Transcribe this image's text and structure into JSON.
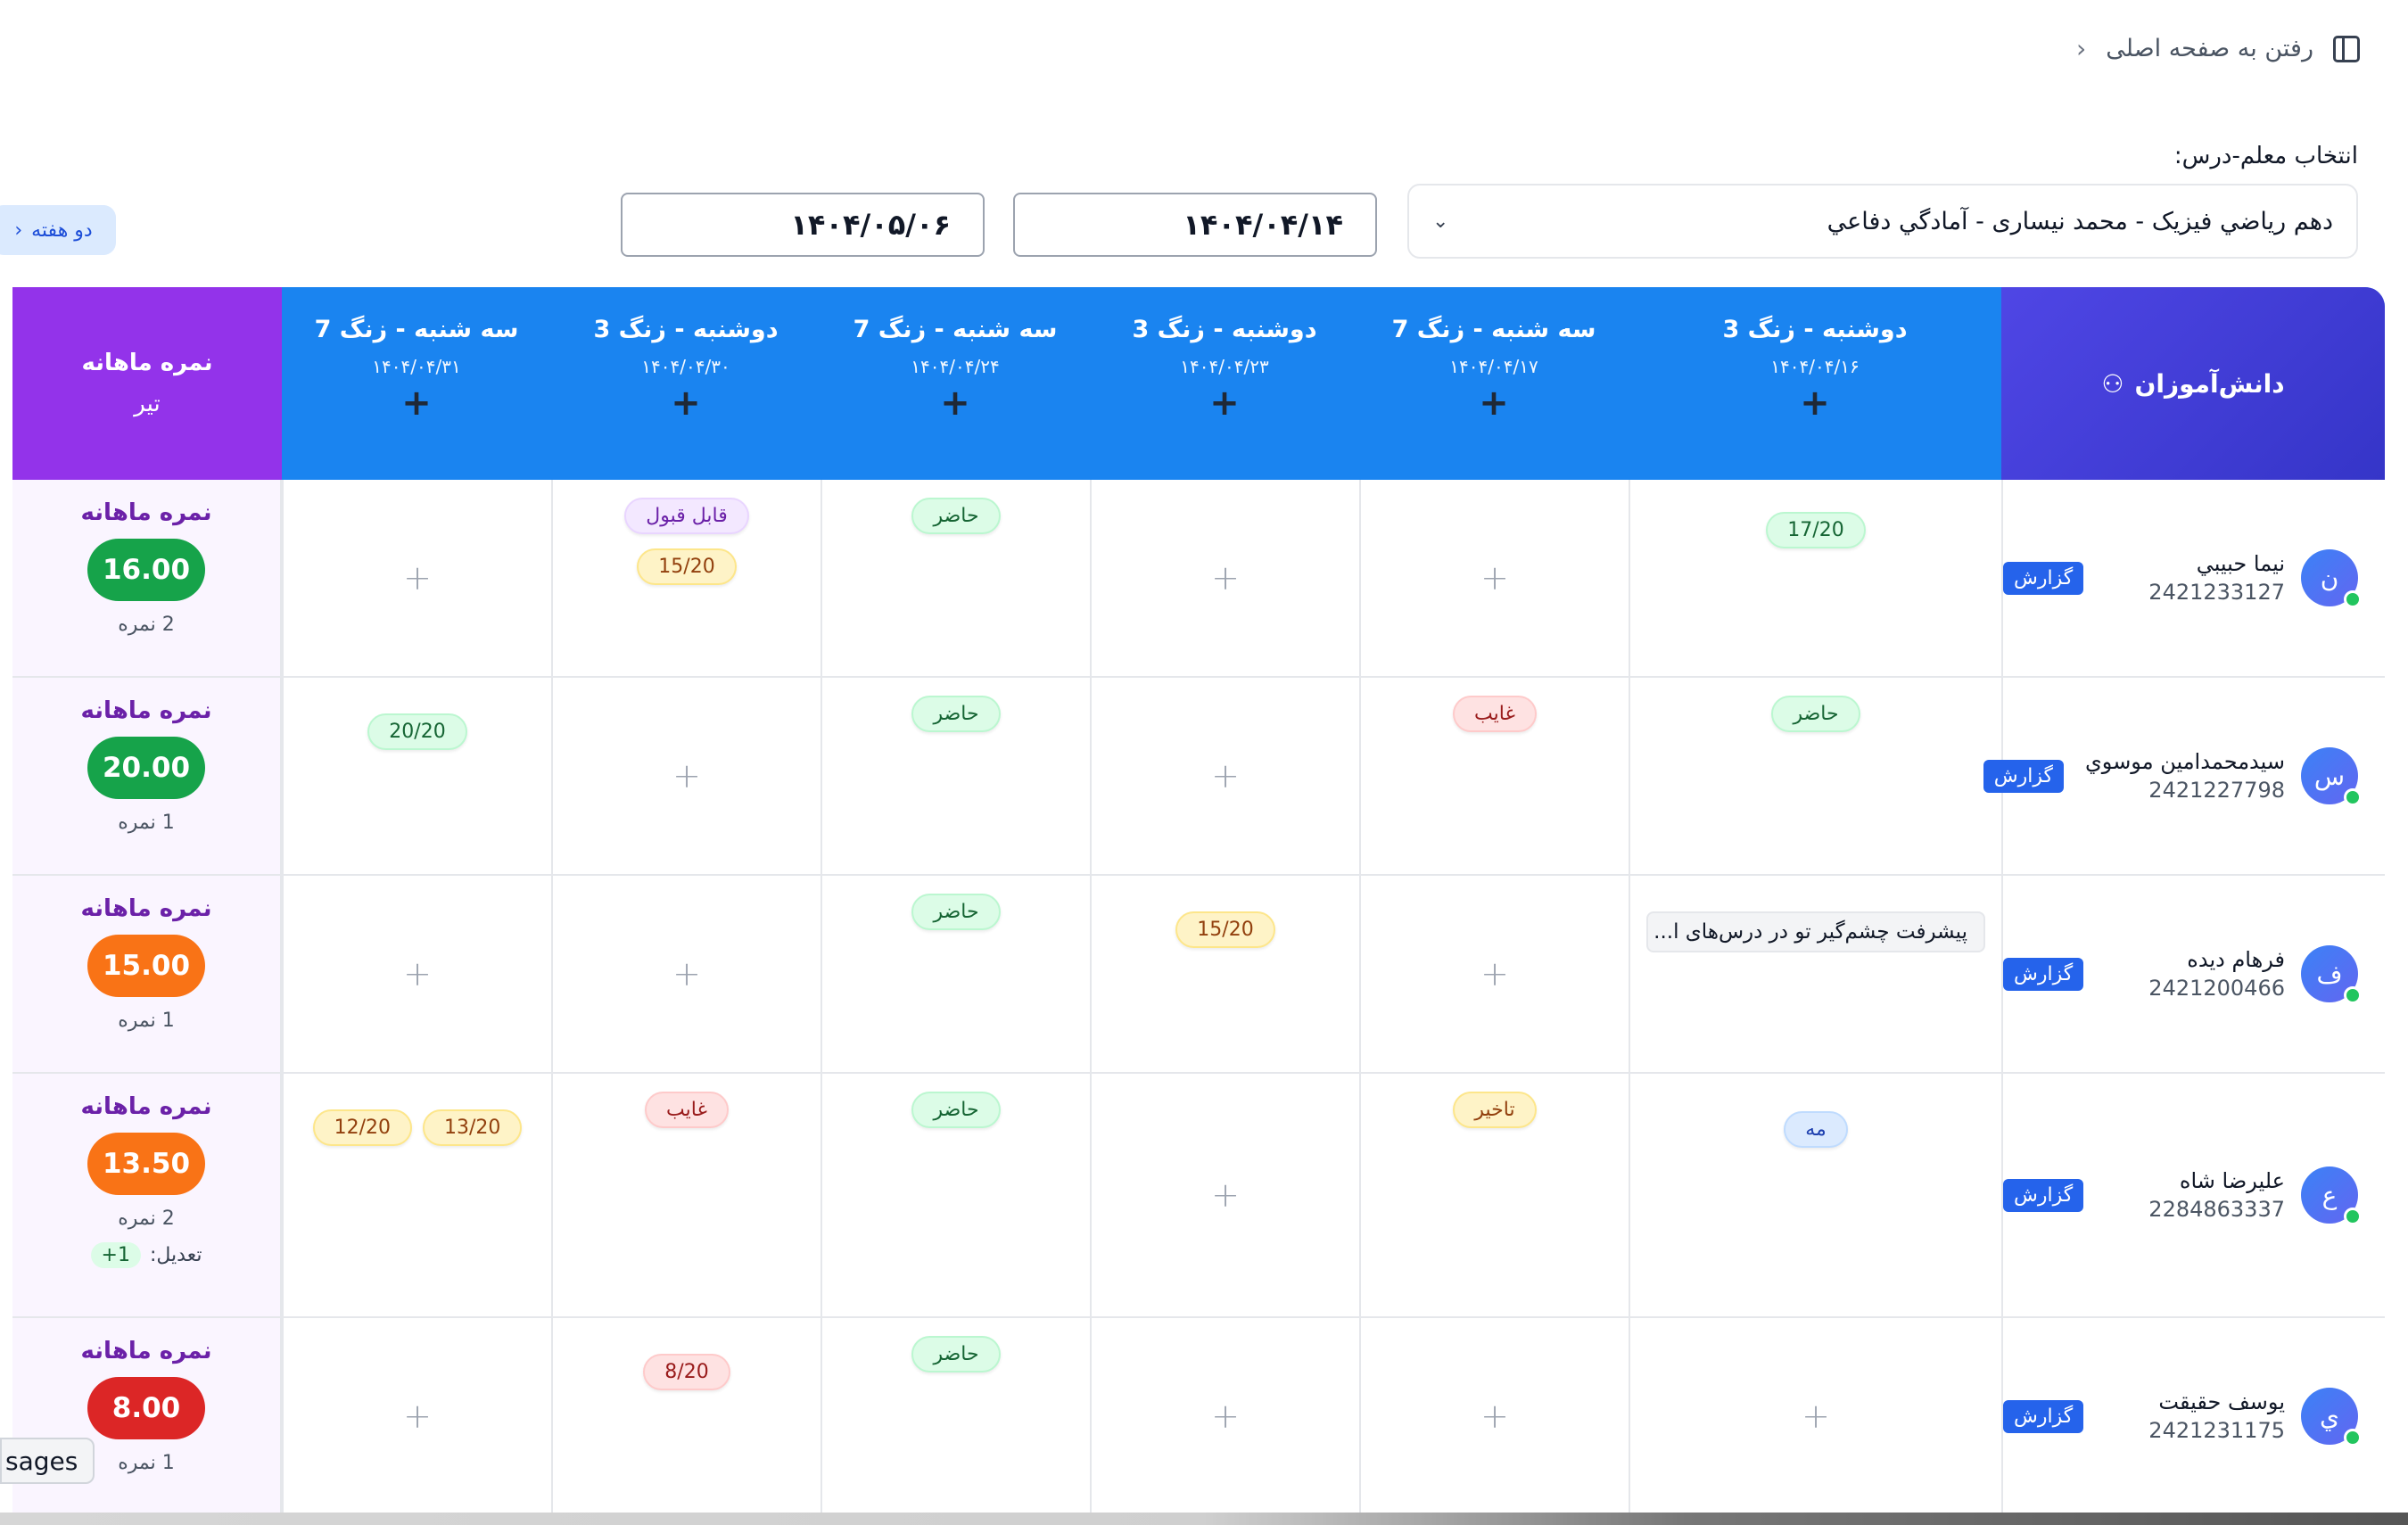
{
  "topbar": {
    "home_link": "رفتن به صفحه اصلی"
  },
  "filters": {
    "label": "انتخاب معلم-درس:",
    "course": "دهم رياضي فيزيک - محمد نيساری - آمادگي دفاعي",
    "date_from": "۱۴۰۴/۰۴/۱۴",
    "date_to": "۱۴۰۴/۰۵/۰۶",
    "period_button": "دو هفته"
  },
  "header": {
    "students": "دانش‌آموزان",
    "monthly_title": "نمره ماهانه",
    "monthly_month": "تیر",
    "add_symbol": "+",
    "sessions": [
      {
        "title": "دوشنبه - زنگ 3",
        "date": "۱۴۰۴/۰۴/۱۶"
      },
      {
        "title": "سه شنبه - زنگ 7",
        "date": "۱۴۰۴/۰۴/۱۷"
      },
      {
        "title": "دوشنبه - زنگ 3",
        "date": "۱۴۰۴/۰۴/۲۳"
      },
      {
        "title": "سه شنبه - زنگ 7",
        "date": "۱۴۰۴/۰۴/۲۴"
      },
      {
        "title": "دوشنبه - زنگ 3",
        "date": "۱۴۰۴/۰۴/۳۰"
      },
      {
        "title": "سه شنبه - زنگ 7",
        "date": "۱۴۰۴/۰۴/۳۱"
      }
    ]
  },
  "labels": {
    "report": "گزارش",
    "monthly_label": "نمره ماهانه",
    "adjust": "تعدیل:",
    "plus": "+"
  },
  "students": [
    {
      "initial": "ن",
      "name": "نيما حبيبي",
      "id": "2421233127",
      "cells": [
        [
          {
            "text": "17/20",
            "color": "green"
          }
        ],
        [],
        [],
        [
          {
            "text": "حاضر",
            "color": "green"
          }
        ],
        [
          {
            "text": "قابل قبول",
            "color": "purple"
          },
          {
            "text": "15/20",
            "color": "yellow"
          }
        ],
        []
      ],
      "score": "16.00",
      "score_color": "g",
      "count": "2 نمره"
    },
    {
      "initial": "س",
      "name": "سيدمحمدامين موسوي",
      "id": "2421227798",
      "cells": [
        [
          {
            "text": "حاضر",
            "color": "green"
          }
        ],
        [
          {
            "text": "غايب",
            "color": "red"
          }
        ],
        [],
        [
          {
            "text": "حاضر",
            "color": "green"
          }
        ],
        [],
        [
          {
            "text": "20/20",
            "color": "green"
          }
        ]
      ],
      "score": "20.00",
      "score_color": "g",
      "count": "1 نمره"
    },
    {
      "initial": "ف",
      "name": "فرهام ديده",
      "id": "2421200466",
      "cells": [
        [
          {
            "text": "پیشرفت چشم‌گیر تو در درس‌های ا...",
            "color": "note"
          }
        ],
        [],
        [
          {
            "text": "15/20",
            "color": "yellow"
          }
        ],
        [
          {
            "text": "حاضر",
            "color": "green"
          }
        ],
        [],
        []
      ],
      "score": "15.00",
      "score_color": "o",
      "count": "1 نمره"
    },
    {
      "initial": "ع",
      "name": "عليرضا شاه",
      "id": "2284863337",
      "cells": [
        [
          {
            "text": "مه",
            "color": "blue"
          }
        ],
        [
          {
            "text": "تاخير",
            "color": "yellow"
          }
        ],
        [],
        [
          {
            "text": "حاضر",
            "color": "green"
          }
        ],
        [
          {
            "text": "غايب",
            "color": "red"
          }
        ],
        [
          {
            "text": "12/20",
            "color": "yellow"
          },
          {
            "text": "13/20",
            "color": "yellow"
          }
        ]
      ],
      "score": "13.50",
      "score_color": "o",
      "count": "2 نمره",
      "adjust": "1+"
    },
    {
      "initial": "ي",
      "name": "يوسف حقيقت",
      "id": "2421231175",
      "cells": [
        [],
        [],
        [],
        [
          {
            "text": "حاضر",
            "color": "green"
          }
        ],
        [
          {
            "text": "8/20",
            "color": "red"
          }
        ],
        []
      ],
      "score": "8.00",
      "score_color": "r",
      "count": "1 نمره"
    }
  ],
  "floating": {
    "messages_tab": "sages"
  }
}
